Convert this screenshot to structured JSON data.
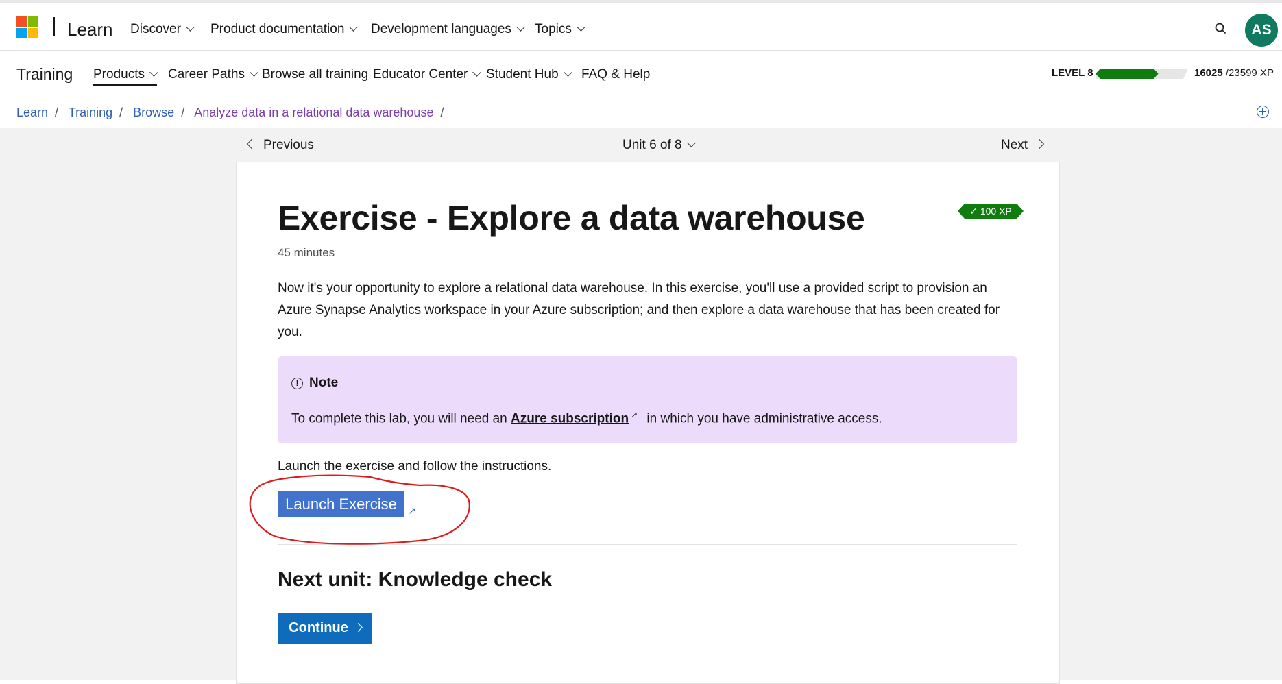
{
  "global_header": {
    "brand": "Learn",
    "nav": [
      "Discover",
      "Product documentation",
      "Development languages",
      "Topics"
    ],
    "avatar_initials": "AS"
  },
  "training_header": {
    "title": "Training",
    "nav": [
      "Products",
      "Career Paths",
      "Browse all training",
      "Educator Center",
      "Student Hub",
      "FAQ & Help"
    ],
    "level_label": "LEVEL 8",
    "xp_current": "16025",
    "xp_total": "/23599 XP",
    "xp_progress": 0.679
  },
  "breadcrumb": [
    "Learn",
    "Training",
    "Browse",
    "Analyze data in a relational data warehouse"
  ],
  "unit_nav": {
    "previous": "Previous",
    "position": "Unit 6 of 8",
    "next": "Next"
  },
  "content": {
    "title": "Exercise - Explore a data warehouse",
    "xp_badge": "100 XP",
    "duration": "45 minutes",
    "intro": "Now it's your opportunity to explore a relational data warehouse. In this exercise, you'll use a provided script to provision an Azure Synapse Analytics workspace in your Azure subscription; and then explore a data warehouse that has been created for you.",
    "note": {
      "title": "Note",
      "text_before": "To complete this lab, you will need an ",
      "link": "Azure subscription",
      "text_after": " in which you have administrative access."
    },
    "launch_text": "Launch the exercise and follow the instructions.",
    "launch_button": "Launch Exercise",
    "next_unit": "Next unit: Knowledge check",
    "continue_button": "Continue"
  },
  "colors": {
    "accent": "#0f6cbd",
    "xp_green": "#107c10",
    "note_bg": "#ecdbfa",
    "launch_bg": "#4273cc",
    "annotation": "#e01b1b"
  }
}
